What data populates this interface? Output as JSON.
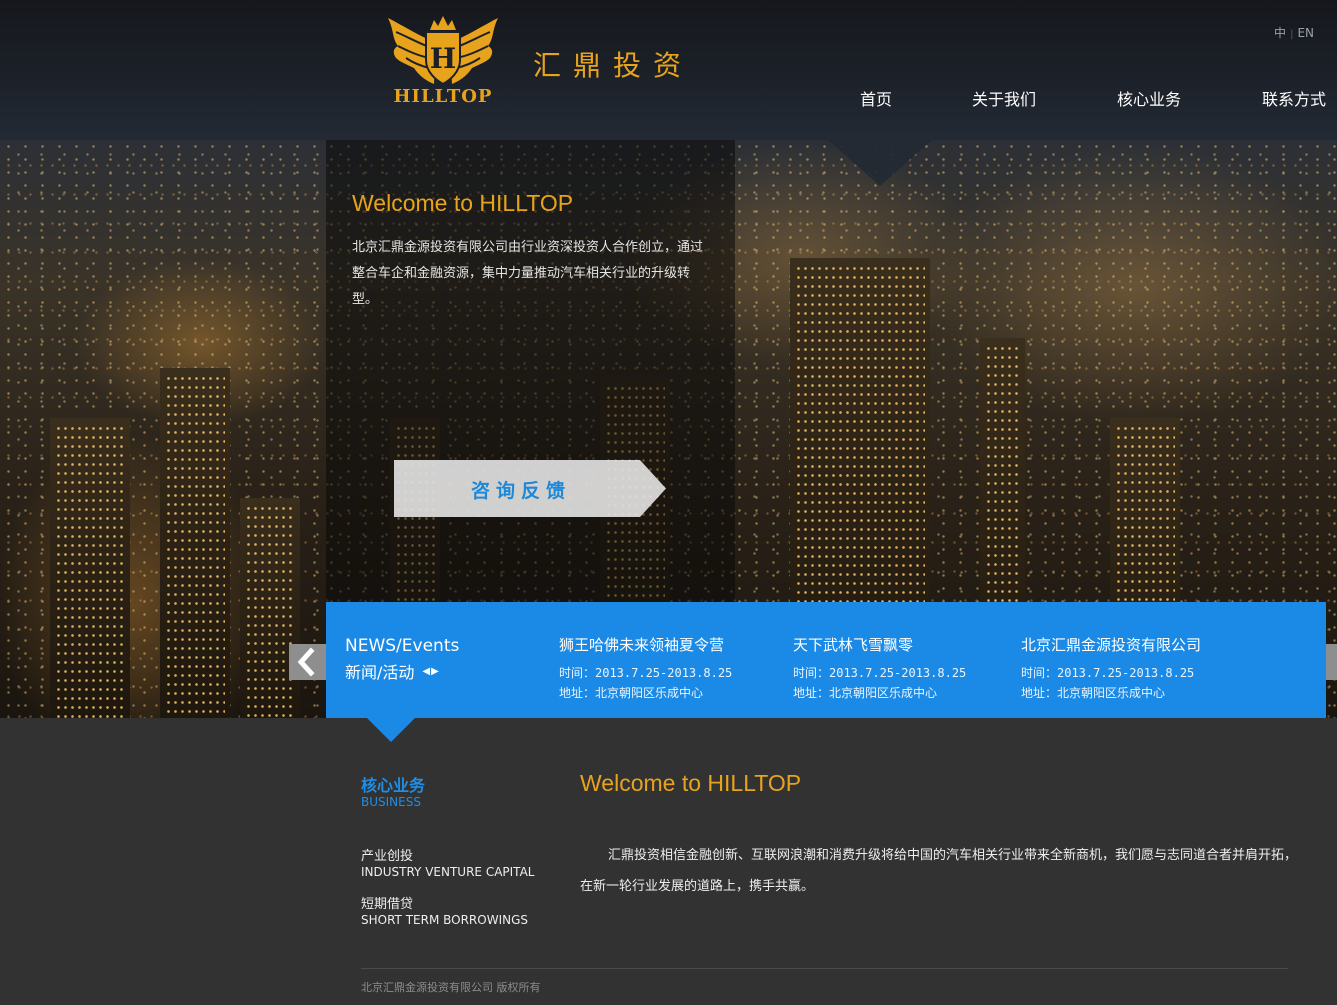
{
  "header": {
    "logo_text": "HILLTOP",
    "brand_cn": "汇鼎投资",
    "lang": {
      "zh": "中",
      "en": "EN"
    },
    "nav": [
      {
        "label": "首页"
      },
      {
        "label": "关于我们"
      },
      {
        "label": "核心业务"
      },
      {
        "label": "联系方式"
      }
    ]
  },
  "hero": {
    "title": "Welcome to HILLTOP",
    "text": "北京汇鼎金源投资有限公司由行业资深投资人合作创立，通过整合车企和金融资源，集中力量推动汽车相关行业的升级转型。",
    "button_label": "咨询反馈"
  },
  "news": {
    "heading_en": "NEWS/Events",
    "heading_cn": "新闻/活动",
    "items": [
      {
        "title": "狮王哈佛未来领袖夏令营",
        "time": "时间：2013.7.25-2013.8.25",
        "address": "地址：北京朝阳区乐成中心"
      },
      {
        "title": "天下武林飞雪飘零",
        "time": "时间：2013.7.25-2013.8.25",
        "address": "地址：北京朝阳区乐成中心"
      },
      {
        "title": "北京汇鼎金源投资有限公司",
        "time": "时间：2013.7.25-2013.8.25",
        "address": "地址：北京朝阳区乐成中心"
      }
    ]
  },
  "core": {
    "title": "核心业务",
    "subtitle": "BUSINESS",
    "services": [
      {
        "cn": "产业创投",
        "en": "INDUSTRY VENTURE CAPITAL"
      },
      {
        "cn": "短期借贷",
        "en": "SHORT TERM BORROWINGS"
      }
    ]
  },
  "about": {
    "title": "Welcome to HILLTOP",
    "text": "汇鼎投资相信金融创新、互联网浪潮和消费升级将给中国的汽车相关行业带来全新商机，我们愿与志同道合者并肩开拓，在新一轮行业发展的道路上，携手共赢。"
  },
  "footer": {
    "copyright": "北京汇鼎金源投资有限公司   版权所有"
  },
  "colors": {
    "gold": "#e8a31c",
    "blue": "#1a8ae6",
    "dark_bg": "#323232"
  }
}
